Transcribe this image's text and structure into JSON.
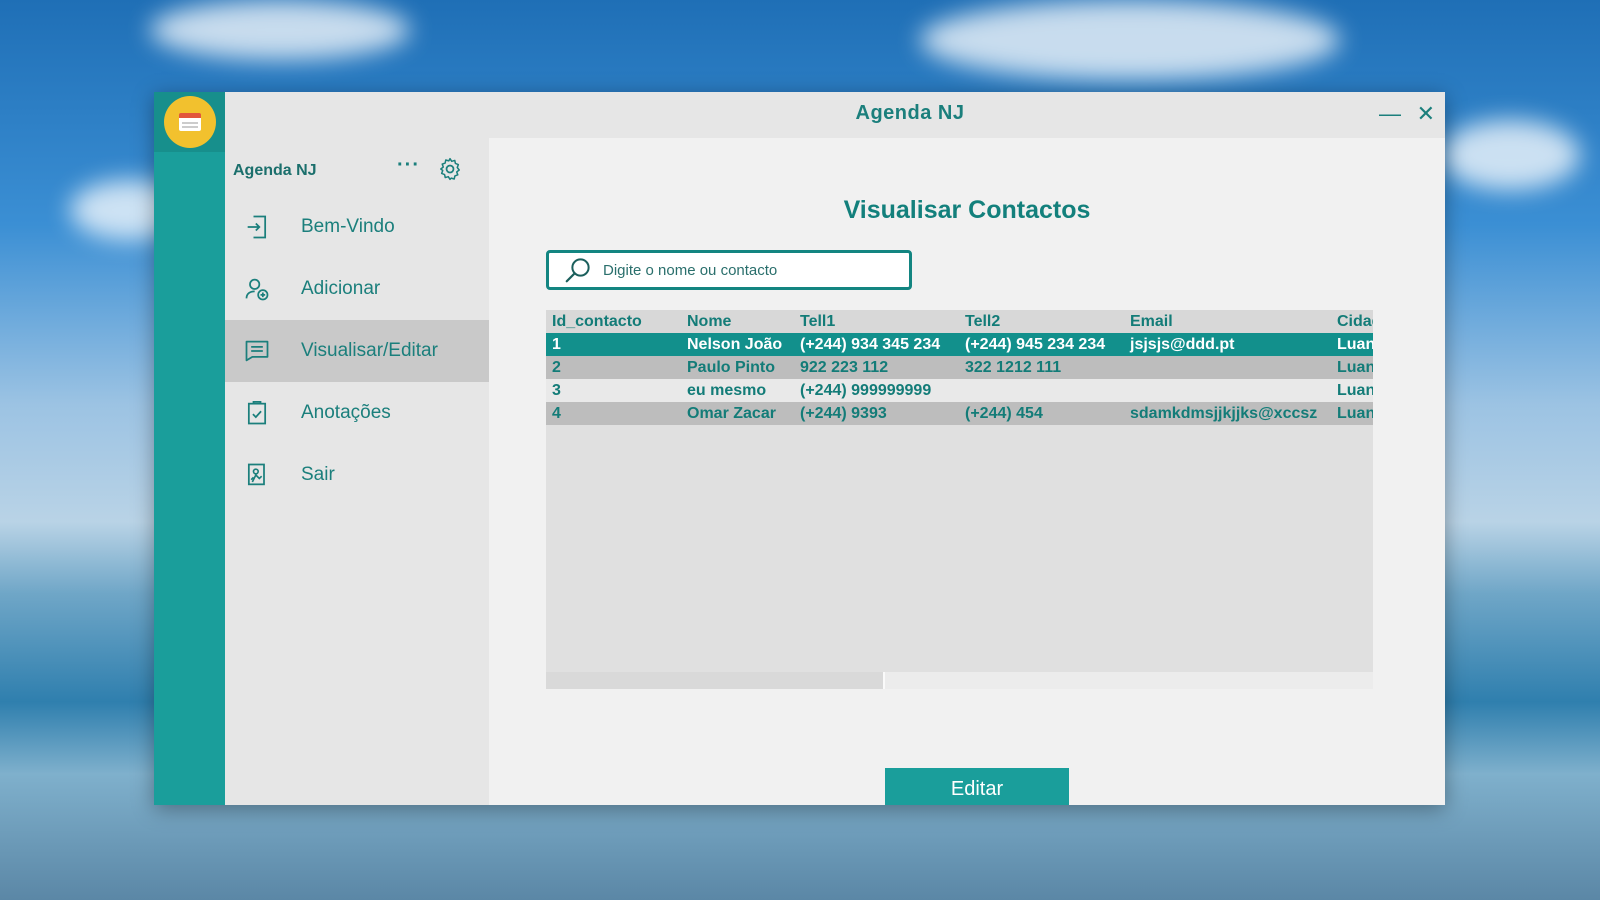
{
  "app": {
    "title": "Agenda NJ"
  },
  "sidebar": {
    "header": "Agenda NJ",
    "more_glyph": "···",
    "items": [
      {
        "label": "Bem-Vindo",
        "icon": "login-icon"
      },
      {
        "label": "Adicionar",
        "icon": "add-user-icon"
      },
      {
        "label": "Visualisar/Editar",
        "icon": "message-list-icon",
        "active": true
      },
      {
        "label": "Anotações",
        "icon": "clipboard-check-icon"
      },
      {
        "label": "Sair",
        "icon": "exit-icon"
      }
    ]
  },
  "main": {
    "title": "Visualisar Contactos",
    "search": {
      "placeholder": "Digite o nome ou contacto",
      "value": ""
    },
    "table": {
      "columns": [
        "Id_contacto",
        "Nome",
        "Tell1",
        "Tell2",
        "Email",
        "Cidade"
      ],
      "rows": [
        [
          "1",
          "Nelson João",
          "(+244) 934 345 234",
          "(+244) 945 234 234",
          "jsjsjs@ddd.pt",
          "Luanda"
        ],
        [
          "2",
          "Paulo Pinto",
          "922 223 112",
          "322 1212 111",
          "",
          "Luanda"
        ],
        [
          "3",
          "eu mesmo",
          "(+244) 999999999",
          "",
          "",
          "Luanda"
        ],
        [
          "4",
          "Omar Zacar",
          "(+244) 9393",
          "(+244) 454",
          "sdamkdmsjjkjjks@xccsz",
          "Luanda"
        ]
      ],
      "selected_row": 0
    },
    "edit_label": "Editar"
  },
  "colors": {
    "accent": "#1a9e9b",
    "accent_dark": "#137c78",
    "logo": "#f2c12e"
  }
}
